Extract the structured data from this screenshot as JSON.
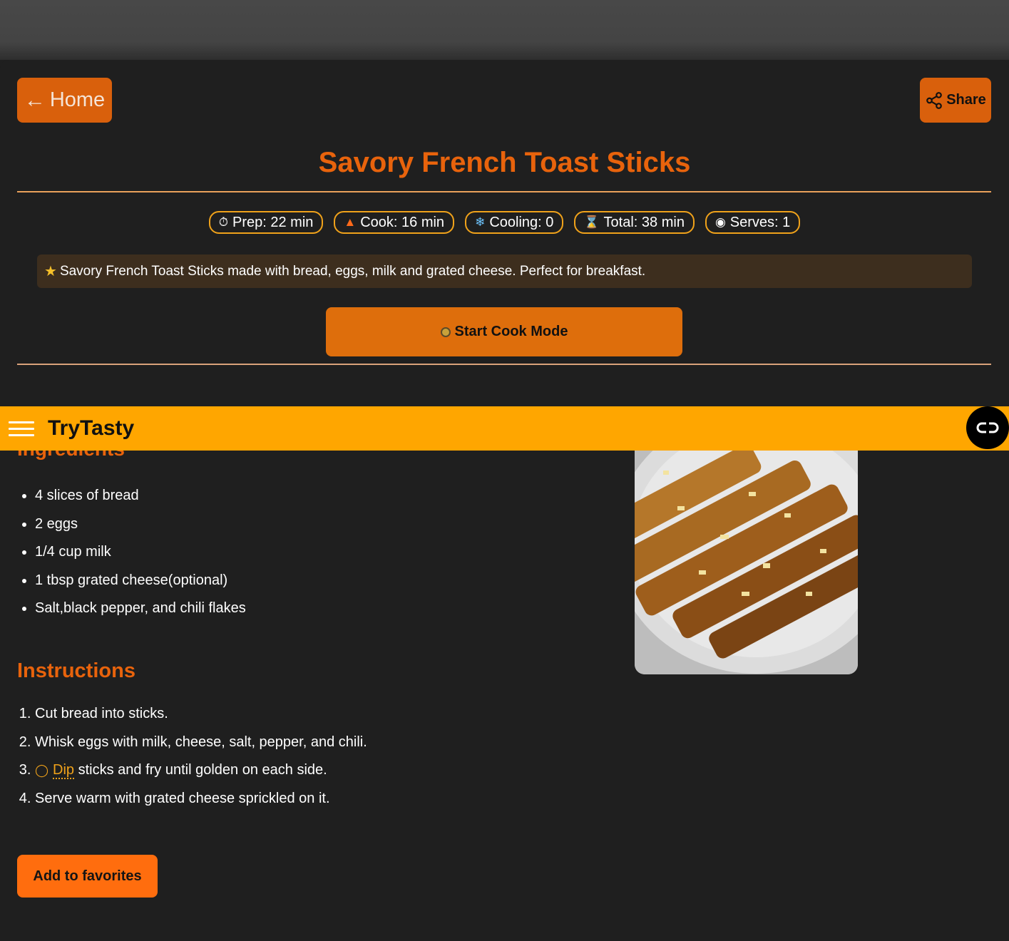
{
  "nav": {
    "home_label": "Home",
    "share_label": "Share",
    "brand": "TryTasty"
  },
  "recipe": {
    "title": "Savory French Toast Sticks",
    "chips": [
      {
        "icon": "stopwatch-icon",
        "label": "Prep: 22 min"
      },
      {
        "icon": "fire-icon",
        "label": "Cook: 16 min"
      },
      {
        "icon": "snowflake-icon",
        "label": "Cooling: 0"
      },
      {
        "icon": "hourglass-icon",
        "label": "Total: 38 min"
      },
      {
        "icon": "plate-icon",
        "label": "Serves: 1"
      }
    ],
    "description": "Savory French Toast Sticks made with bread, eggs, milk and grated cheese. Perfect for breakfast.",
    "cook_mode_label": "Start Cook Mode",
    "ingredients_heading": "Ingredients",
    "ingredients": [
      "4 slices of bread",
      "2 eggs",
      "1/4 cup milk",
      "1 tbsp grated cheese(optional)",
      "Salt,black pepper, and chili flakes"
    ],
    "instructions_heading": "Instructions",
    "instructions": {
      "step1": "Cut bread into sticks.",
      "step2": "Whisk eggs with milk, cheese, salt, pepper, and chili.",
      "step3_link": "Dip",
      "step3_rest": " sticks and fry until golden on each side.",
      "step4": "Serve warm with grated cheese sprickled on it."
    },
    "favorites_label": "Add to favorites"
  },
  "colors": {
    "accent_orange": "#e8630c",
    "navbar_yellow": "#ffa600",
    "background": "#1f1f1f"
  }
}
